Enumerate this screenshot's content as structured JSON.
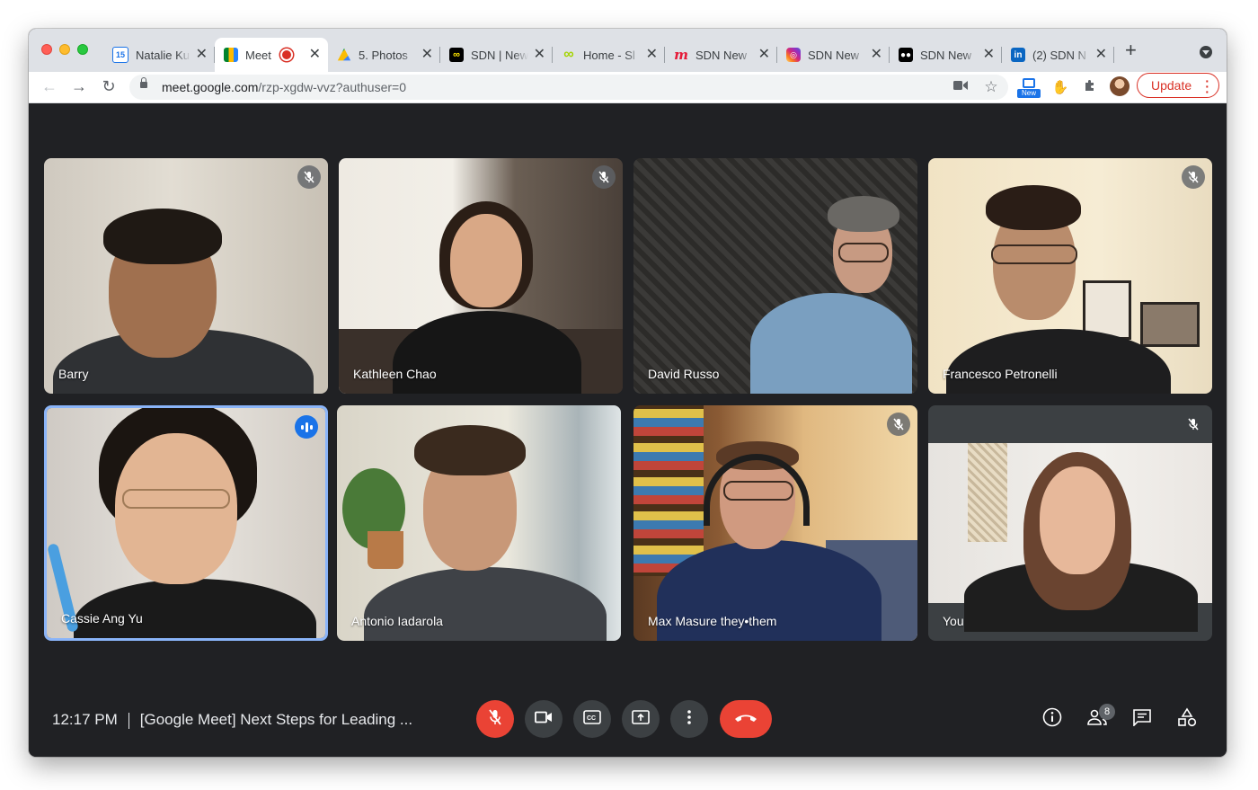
{
  "browser": {
    "tabs": [
      {
        "title": "Natalie Ku",
        "icon": "calendar-icon",
        "active": false
      },
      {
        "title": "Meet",
        "icon": "meet-icon",
        "active": true,
        "recording": true
      },
      {
        "title": "5. Photos",
        "icon": "drive-icon",
        "active": false
      },
      {
        "title": "SDN | New",
        "icon": "sdn-icon",
        "active": false
      },
      {
        "title": "Home - Sl",
        "icon": "infinity-icon",
        "active": false
      },
      {
        "title": "SDN New",
        "icon": "meetup-icon",
        "active": false
      },
      {
        "title": "SDN New",
        "icon": "instagram-icon",
        "active": false
      },
      {
        "title": "SDN New",
        "icon": "medium-icon",
        "active": false
      },
      {
        "title": "(2) SDN N",
        "icon": "linkedin-icon",
        "active": false
      }
    ],
    "calendar_day": "15",
    "url_host": "meet.google.com",
    "url_path": "/rzp-xgdw-vvz?authuser=0",
    "new_badge": "New",
    "update_label": "Update"
  },
  "meet": {
    "participants": [
      {
        "name": "Barry",
        "muted": true,
        "speaking": false
      },
      {
        "name": "Kathleen Chao",
        "muted": true,
        "speaking": false
      },
      {
        "name": "David Russo",
        "muted": false,
        "speaking": false
      },
      {
        "name": "Francesco Petronelli",
        "muted": true,
        "speaking": false
      },
      {
        "name": "Cassie Ang Yu",
        "muted": false,
        "speaking": true
      },
      {
        "name": "Antonio Iadarola",
        "muted": false,
        "speaking": false
      },
      {
        "name": "Max Masure they•them",
        "muted": true,
        "speaking": false
      },
      {
        "name": "You",
        "muted": true,
        "speaking": false
      }
    ],
    "time": "12:17 PM",
    "meeting_title": "[Google Meet] Next Steps for Leading ...",
    "participant_count": "8",
    "colors": {
      "background": "#202124",
      "end_call": "#ea4335",
      "speaking": "#1a73e8",
      "mic_off": "#ea4335"
    }
  }
}
